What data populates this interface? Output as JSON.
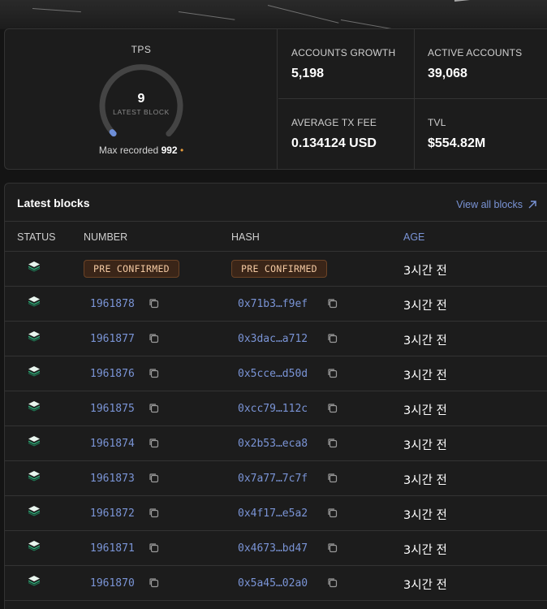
{
  "tps": {
    "title": "TPS",
    "value": "9",
    "sublabel": "LATEST BLOCK",
    "max_prefix": "Max recorded",
    "max_value": "992",
    "max_marker": "•"
  },
  "metrics": {
    "accounts_growth": {
      "label": "ACCOUNTS GROWTH",
      "value": "5,198"
    },
    "active_accounts": {
      "label": "ACTIVE ACCOUNTS",
      "value": "39,068"
    },
    "avg_tx_fee": {
      "label": "AVERAGE TX FEE",
      "value": "0.134124 USD"
    },
    "tvl": {
      "label": "TVL",
      "value": "$554.82M"
    }
  },
  "blocks": {
    "title": "Latest blocks",
    "view_all": "View all blocks",
    "columns": {
      "status": "STATUS",
      "number": "NUMBER",
      "hash": "HASH",
      "age": "AGE"
    },
    "pending": {
      "number_badge": "PRE CONFIRMED",
      "hash_badge": "PRE CONFIRMED",
      "age": "3시간 전"
    },
    "rows": [
      {
        "number": "1961878",
        "hash": "0x71b3…f9ef",
        "age": "3시간 전"
      },
      {
        "number": "1961877",
        "hash": "0x3dac…a712",
        "age": "3시간 전"
      },
      {
        "number": "1961876",
        "hash": "0x5cce…d50d",
        "age": "3시간 전"
      },
      {
        "number": "1961875",
        "hash": "0xcc79…112c",
        "age": "3시간 전"
      },
      {
        "number": "1961874",
        "hash": "0x2b53…eca8",
        "age": "3시간 전"
      },
      {
        "number": "1961873",
        "hash": "0x7a77…7c7f",
        "age": "3시간 전"
      },
      {
        "number": "1961872",
        "hash": "0x4f17…e5a2",
        "age": "3시간 전"
      },
      {
        "number": "1961871",
        "hash": "0x4673…bd47",
        "age": "3시간 전"
      },
      {
        "number": "1961870",
        "hash": "0x5a45…02a0",
        "age": "3시간 전"
      }
    ]
  },
  "colors": {
    "accent": "#7a94d6",
    "badge_text": "#f3c9a2",
    "badge_bg": "#3a2518",
    "status_icon": "#2fae7a"
  },
  "icons": {
    "status": "layers-stack-icon",
    "copy": "copy-icon",
    "view_all": "arrow-up-right-icon"
  }
}
